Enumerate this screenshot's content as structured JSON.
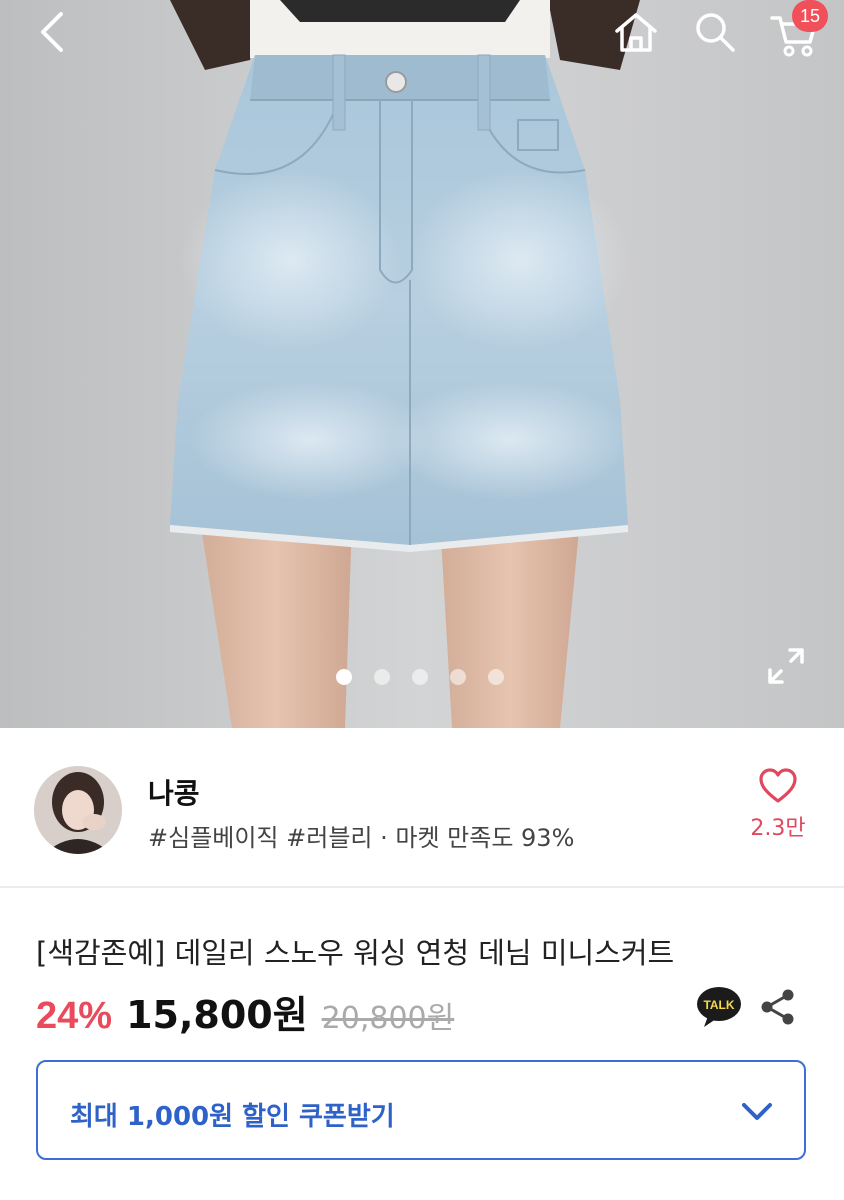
{
  "header": {
    "back_icon": "chevron-left-icon",
    "home_icon": "home-icon",
    "search_icon": "search-icon",
    "cart_icon": "cart-icon",
    "cart_count": "15"
  },
  "gallery": {
    "total_images": 5,
    "active_index": 0,
    "expand_icon": "expand-icon"
  },
  "seller": {
    "name": "나콩",
    "tags": "#심플베이직 #러블리 · 마켓 만족도 93%",
    "like_count": "2.3만"
  },
  "product": {
    "title": "[색감존예] 데일리 스노우 워싱 연청 데님 미니스커트",
    "discount": "24%",
    "price": "15,800원",
    "original_price": "20,800원"
  },
  "actions": {
    "talk_label": "TALK",
    "share_icon": "share-icon"
  },
  "coupon": {
    "label": "최대 1,000원 할인 쿠폰받기"
  },
  "colors": {
    "accent": "#e94b5c",
    "coupon_blue": "#2f62c8",
    "badge": "#f0505a"
  }
}
